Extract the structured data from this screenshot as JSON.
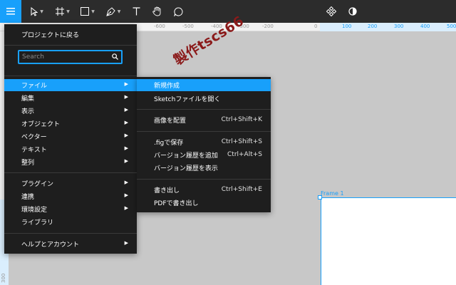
{
  "toolbar": {
    "tools": [
      {
        "name": "menu-icon"
      },
      {
        "name": "move-tool-icon"
      },
      {
        "name": "frame-tool-icon"
      },
      {
        "name": "shape-tool-icon"
      },
      {
        "name": "pen-tool-icon"
      },
      {
        "name": "text-tool-icon"
      },
      {
        "name": "hand-tool-icon"
      },
      {
        "name": "comment-tool-icon"
      },
      {
        "name": "components-icon"
      },
      {
        "name": "contrast-icon"
      }
    ],
    "accent": "#18a0fb"
  },
  "ruler": {
    "top_ticks": [
      "-600",
      "-500",
      "-400",
      "-300",
      "-200",
      "0",
      "100",
      "200",
      "300",
      "400",
      "500"
    ],
    "left_ticks": [
      "300"
    ]
  },
  "canvas": {
    "frame_label": "Frame 1"
  },
  "menu": {
    "back": "プロジェクトに戻る",
    "search_placeholder": "Search",
    "items": [
      {
        "label": "ファイル"
      },
      {
        "label": "編集"
      },
      {
        "label": "表示"
      },
      {
        "label": "オブジェクト"
      },
      {
        "label": "ベクター"
      },
      {
        "label": "テキスト"
      },
      {
        "label": "整列"
      },
      {
        "label": "プラグイン"
      },
      {
        "label": "連携"
      },
      {
        "label": "環境設定"
      },
      {
        "label": "ライブラリ"
      },
      {
        "label": "ヘルプとアカウント"
      }
    ]
  },
  "submenu": {
    "items": [
      {
        "label": "新規作成",
        "shortcut": ""
      },
      {
        "label": "Sketchファイルを開く",
        "shortcut": ""
      },
      {
        "label": "画像を配置",
        "shortcut": "Ctrl+Shift+K"
      },
      {
        "label": ".figで保存",
        "shortcut": "Ctrl+Shift+S"
      },
      {
        "label": "バージョン履歴を追加",
        "shortcut": "Ctrl+Alt+S"
      },
      {
        "label": "バージョン履歴を表示",
        "shortcut": ""
      },
      {
        "label": "書き出し",
        "shortcut": "Ctrl+Shift+E"
      },
      {
        "label": "PDFで書き出し",
        "shortcut": ""
      }
    ]
  },
  "watermark": "製作tscs66"
}
